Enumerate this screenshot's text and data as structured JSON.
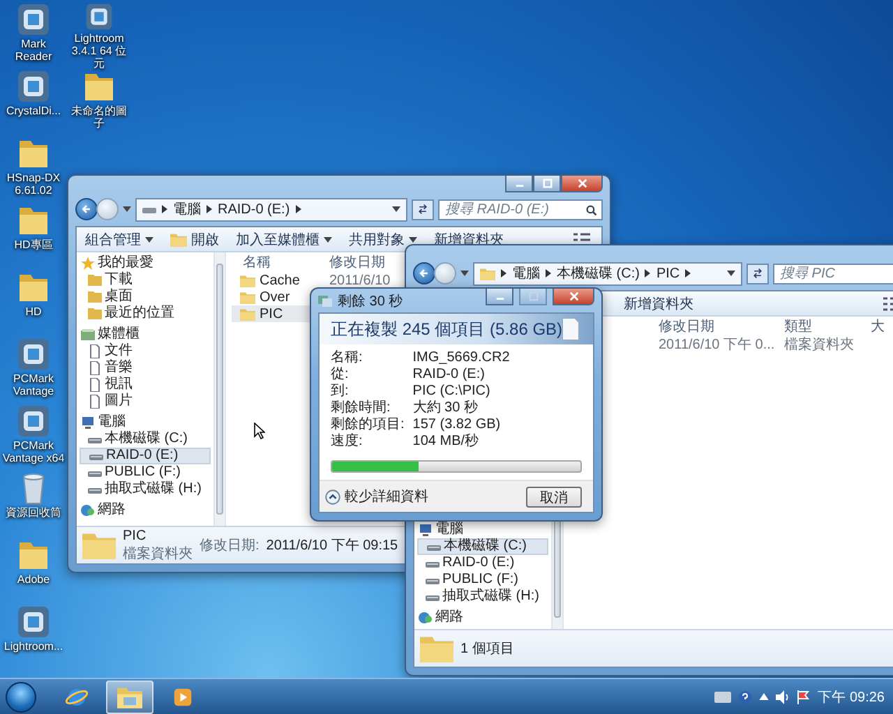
{
  "desktop_icons": [
    {
      "label": "Mark Reader",
      "kind": "app"
    },
    {
      "label": "Lightroom 3.4.1 64 位元",
      "kind": "app"
    },
    {
      "label": "CrystalDi...",
      "kind": "app"
    },
    {
      "label": "未命名的圖子",
      "kind": "folder"
    },
    {
      "label": "HSnap-DX 6.61.02",
      "kind": "folder"
    },
    {
      "label": "HD專區",
      "kind": "folder"
    },
    {
      "label": "HD",
      "kind": "folder"
    },
    {
      "label": "PCMark Vantage",
      "kind": "app"
    },
    {
      "label": "PCMark Vantage x64",
      "kind": "app"
    },
    {
      "label": "資源回收筒",
      "kind": "bin"
    },
    {
      "label": "Adobe",
      "kind": "folder"
    },
    {
      "label": "Lightroom...",
      "kind": "app"
    }
  ],
  "explorer_1": {
    "breadcrumbs": [
      "電腦",
      "RAID-0 (E:)"
    ],
    "search": {
      "placeholder": "搜尋 RAID-0 (E:)"
    },
    "toolbar": [
      {
        "label": "組合管理",
        "kind": "menu"
      },
      {
        "label": "開啟",
        "kind": "icon"
      },
      {
        "label": "加入至媒體櫃",
        "kind": "menu"
      },
      {
        "label": "共用對象",
        "kind": "menu"
      },
      {
        "label": "新增資料夾",
        "kind": "plain"
      }
    ],
    "nav": [
      {
        "label": "我的最愛",
        "kind": "favorites",
        "selected": false,
        "children": [
          {
            "label": "下載",
            "selected": false
          },
          {
            "label": "桌面",
            "selected": false
          },
          {
            "label": "最近的位置",
            "selected": false
          }
        ]
      },
      {
        "label": "媒體櫃",
        "kind": "libraries",
        "selected": false,
        "children": [
          {
            "label": "文件",
            "selected": false
          },
          {
            "label": "音樂",
            "selected": false
          },
          {
            "label": "視訊",
            "selected": false
          },
          {
            "label": "圖片",
            "selected": false
          }
        ]
      },
      {
        "label": "電腦",
        "kind": "computer",
        "selected": false,
        "children": [
          {
            "label": "本機磁碟 (C:)",
            "selected": false
          },
          {
            "label": "RAID-0 (E:)",
            "selected": true
          },
          {
            "label": "PUBLIC (F:)",
            "selected": false
          },
          {
            "label": "抽取式磁碟 (H:)",
            "selected": false
          }
        ]
      },
      {
        "label": "網路",
        "kind": "network",
        "selected": false
      }
    ],
    "columns": [
      "名稱",
      "修改日期"
    ],
    "rows": [
      {
        "name": "Cache",
        "date": "2011/6/10",
        "selected": false
      },
      {
        "name": "Over",
        "selected": false
      },
      {
        "name": "PIC",
        "selected": true
      }
    ],
    "details": {
      "name": "PIC",
      "type": "檔案資料夾",
      "date_label": "修改日期:",
      "date": "2011/6/10 下午 09:15"
    }
  },
  "explorer_2": {
    "breadcrumbs": [
      "電腦",
      "本機磁碟 (C:)",
      "PIC"
    ],
    "search": {
      "placeholder": "搜尋 PIC"
    },
    "toolbar": [
      {
        "label": "新增資料夾",
        "kind": "plain"
      }
    ],
    "columns": [
      "修改日期",
      "類型",
      "大"
    ],
    "rows": [
      {
        "date": "2011/6/10 下午 0...",
        "type": "檔案資料夾"
      }
    ],
    "nav": [
      {
        "label": "電腦",
        "kind": "computer",
        "selected": false,
        "children": [
          {
            "label": "本機磁碟 (C:)",
            "selected": true
          },
          {
            "label": "RAID-0 (E:)",
            "selected": false
          },
          {
            "label": "PUBLIC (F:)",
            "selected": false
          },
          {
            "label": "抽取式磁碟 (H:)",
            "selected": false
          }
        ]
      },
      {
        "label": "網路",
        "kind": "network",
        "selected": false
      }
    ],
    "status": "1 個項目"
  },
  "copy_dialog": {
    "title": "剩餘 30 秒",
    "heading": "正在複製 245 個項目 (5.86 GB)",
    "details": [
      {
        "label": "名稱:",
        "value": "IMG_5669.CR2"
      },
      {
        "label": "從:",
        "value": "RAID-0 (E:)"
      },
      {
        "label": "到:",
        "value": "PIC (C:\\PIC)"
      },
      {
        "label": "剩餘時間:",
        "value": "大約 30 秒"
      },
      {
        "label": "剩餘的項目:",
        "value": "157 (3.82 GB)"
      },
      {
        "label": "速度:",
        "value": "104 MB/秒"
      }
    ],
    "progress": {
      "level": 0.35
    },
    "toggle": "較少詳細資料",
    "cancel": "取消"
  },
  "taskbar": {
    "apps": [
      {
        "kind": "browser",
        "selected": false
      },
      {
        "kind": "explorer",
        "selected": true
      },
      {
        "kind": "media",
        "selected": false
      }
    ],
    "clock": "下午 09:26"
  }
}
